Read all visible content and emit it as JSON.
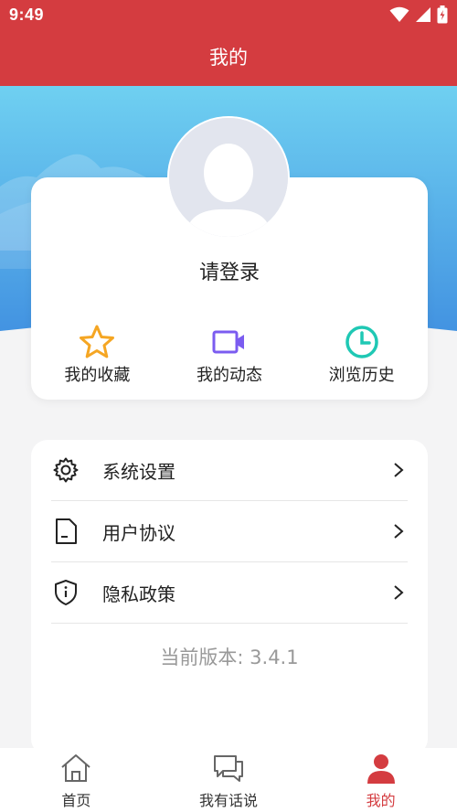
{
  "status_bar": {
    "time": "9:49"
  },
  "header": {
    "title": "我的"
  },
  "profile": {
    "login_prompt": "请登录",
    "quick_actions": [
      {
        "label": "我的收藏",
        "icon": "star-icon",
        "color": "#f5a623"
      },
      {
        "label": "我的动态",
        "icon": "video-icon",
        "color": "#7b5cf0"
      },
      {
        "label": "浏览历史",
        "icon": "clock-icon",
        "color": "#1fc8b4"
      }
    ]
  },
  "menu": {
    "items": [
      {
        "label": "系统设置",
        "icon": "gear-icon"
      },
      {
        "label": "用户协议",
        "icon": "document-icon"
      },
      {
        "label": "隐私政策",
        "icon": "shield-icon"
      }
    ],
    "version": "当前版本: 3.4.1"
  },
  "tab_bar": {
    "tabs": [
      {
        "label": "首页",
        "icon": "home-icon"
      },
      {
        "label": "我有话说",
        "icon": "chat-icon"
      },
      {
        "label": "我的",
        "icon": "user-icon",
        "active": true
      }
    ]
  },
  "colors": {
    "brand": "#d43c40",
    "hero_top": "#6fd0f1",
    "hero_bottom": "#3f8ee0"
  }
}
